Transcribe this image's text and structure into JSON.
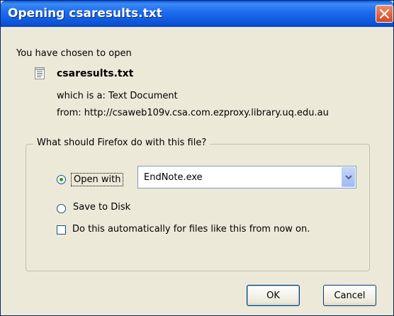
{
  "window": {
    "title": "Opening csaresults.txt",
    "close_icon": "close-icon"
  },
  "info": {
    "intro": "You have chosen to open",
    "file_name": "csaresults.txt",
    "which_is": "which is a:  Text Document",
    "from": "from:  http://csaweb109v.csa.com.ezproxy.library.uq.edu.au",
    "file_icon": "text-document-icon"
  },
  "action_group": {
    "label": "What should Firefox do with this file?",
    "open_with_label": "Open with",
    "open_with_selected": true,
    "open_with_app": "EndNote.exe",
    "save_to_disk_label": "Save to Disk",
    "save_to_disk_selected": false,
    "auto_label": "Do this automatically for files like this from now on.",
    "auto_checked": false
  },
  "buttons": {
    "ok": "OK",
    "cancel": "Cancel"
  }
}
